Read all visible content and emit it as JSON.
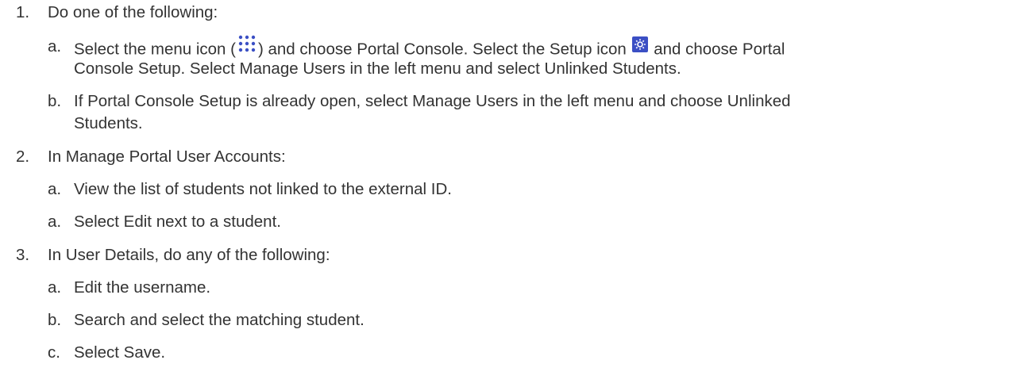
{
  "steps": [
    {
      "number": "1.",
      "text": "Do one of the following:",
      "substeps": [
        {
          "letter": "a.",
          "parts": {
            "p1": "Select the menu icon (",
            "p2": ") and choose Portal Console. Select the Setup icon",
            "p3": "and choose Portal",
            "line2": "Console Setup. Select Manage Users in the left menu and select Unlinked Students."
          }
        },
        {
          "letter": "b.",
          "line1": "If Portal Console Setup is already open, select Manage Users in the left menu and choose Unlinked",
          "line2": "Students."
        }
      ]
    },
    {
      "number": "2.",
      "text": "In Manage Portal User Accounts:",
      "substeps": [
        {
          "letter": "a.",
          "text": "View the list of students not linked to the external ID."
        },
        {
          "letter": "a.",
          "text": "Select Edit next to a student."
        }
      ]
    },
    {
      "number": "3.",
      "text": "In User Details, do any of the following:",
      "substeps": [
        {
          "letter": "a.",
          "text": "Edit the username."
        },
        {
          "letter": "b.",
          "text": "Search and select the matching student."
        },
        {
          "letter": "c.",
          "text": "Select Save."
        }
      ]
    }
  ],
  "icons": {
    "menu_icon": "menu-dots-grid-icon",
    "setup_icon": "setup-gear-icon",
    "menu_icon_color": "#3b4fc4",
    "setup_icon_color": "#3b4fc4"
  }
}
